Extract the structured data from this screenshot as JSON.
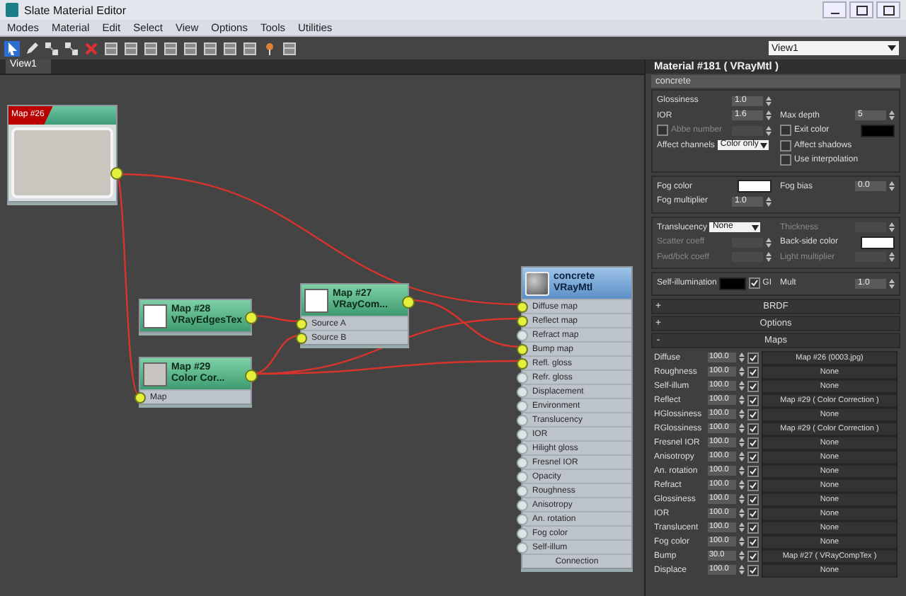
{
  "window": {
    "title": "Slate Material Editor"
  },
  "menu": [
    "Modes",
    "Material",
    "Edit",
    "Select",
    "View",
    "Options",
    "Tools",
    "Utilities"
  ],
  "toolbar": {
    "view_dropdown": "View1"
  },
  "view_tabs": [
    {
      "label": "View1",
      "selected": true
    }
  ],
  "nodes": [
    {
      "kind": "bitmap",
      "tag": "Map #26"
    },
    {
      "kind": "map",
      "title": "Map #28",
      "subtitle": "VRayEdgesTex",
      "color": "#ffffff"
    },
    {
      "kind": "map",
      "title": "Map #29",
      "subtitle": "Color Cor...",
      "color": "#c8c4c0",
      "slots": [
        {
          "label": "Map",
          "connected": true
        }
      ]
    },
    {
      "kind": "map",
      "title": "Map #27",
      "subtitle": "VRayCom...",
      "color": "#ffffff",
      "slots": [
        {
          "label": "Source A",
          "connected": true
        },
        {
          "label": "Source B",
          "connected": true
        }
      ]
    },
    {
      "kind": "material",
      "title": "concrete",
      "subtitle": "VRayMtl",
      "footer": "Connection",
      "slots": [
        {
          "label": "Diffuse map",
          "connected": true
        },
        {
          "label": "Reflect map",
          "connected": true
        },
        {
          "label": "Refract map",
          "connected": false
        },
        {
          "label": "Bump map",
          "connected": true
        },
        {
          "label": "Refl. gloss",
          "connected": true
        },
        {
          "label": "Refr. gloss",
          "connected": false
        },
        {
          "label": "Displacement",
          "connected": false
        },
        {
          "label": "Environment",
          "connected": false
        },
        {
          "label": "Translucency",
          "connected": false
        },
        {
          "label": "IOR",
          "connected": false
        },
        {
          "label": "Hilight gloss",
          "connected": false
        },
        {
          "label": "Fresnel IOR",
          "connected": false
        },
        {
          "label": "Opacity",
          "connected": false
        },
        {
          "label": "Roughness",
          "connected": false
        },
        {
          "label": "Anisotropy",
          "connected": false
        },
        {
          "label": "An. rotation",
          "connected": false
        },
        {
          "label": "Fog color",
          "connected": false
        },
        {
          "label": "Self-illum",
          "connected": false
        }
      ]
    }
  ],
  "panel": {
    "title": "Material #181 ( VRayMtl )",
    "name": "concrete",
    "groups": [
      {
        "rows": [
          {
            "left": {
              "kind": "spinner",
              "label": "Glossiness",
              "value": "1.0",
              "disabled": false
            }
          },
          {
            "left": {
              "kind": "spinner",
              "label": "IOR",
              "value": "1.6",
              "disabled": false
            },
            "right": {
              "kind": "spinner",
              "label": "Max depth",
              "value": "5",
              "disabled": false
            }
          },
          {
            "left": {
              "kind": "checkspinner",
              "label": "Abbe number",
              "checked": false,
              "disabled": true
            },
            "right": {
              "kind": "checkcolor",
              "label": "Exit color",
              "checked": false,
              "color": "#000000"
            }
          },
          {
            "left": {
              "kind": "dropdown",
              "label": "Affect channels",
              "value": "Color only"
            },
            "right": {
              "kind": "check",
              "label": "Affect shadows",
              "checked": false
            }
          },
          {
            "right": {
              "kind": "check",
              "label": "Use interpolation",
              "checked": false
            }
          }
        ]
      },
      {
        "rows": [
          {
            "left": {
              "kind": "color",
              "label": "Fog color",
              "color": "#ffffff"
            },
            "right": {
              "kind": "spinner",
              "label": "Fog bias",
              "value": "0.0",
              "disabled": false
            }
          },
          {
            "left": {
              "kind": "spinner",
              "label": "Fog multiplier",
              "value": "1.0",
              "disabled": false
            }
          }
        ]
      },
      {
        "rows": [
          {
            "left": {
              "kind": "dropdown",
              "label": "Translucency",
              "value": "None"
            },
            "right": {
              "kind": "spinner",
              "label": "Thickness",
              "disabled": true
            }
          },
          {
            "left": {
              "kind": "spinner",
              "label": "Scatter coeff",
              "disabled": true
            },
            "right": {
              "kind": "color",
              "label": "Back-side color",
              "color": "#ffffff"
            }
          },
          {
            "left": {
              "kind": "spinner",
              "label": "Fwd/bck coeff",
              "disabled": true
            },
            "right": {
              "kind": "spinner",
              "label": "Light multiplier",
              "disabled": true
            }
          }
        ]
      },
      {
        "rows": [
          {
            "left": {
              "kind": "colorcheck",
              "label": "Self-illumination",
              "color": "#000000",
              "check_label": "GI",
              "checked": true
            },
            "right": {
              "kind": "spinner",
              "label": "Mult",
              "value": "1.0",
              "disabled": false
            }
          }
        ]
      }
    ],
    "rollouts": [
      {
        "sign": "+",
        "label": "BRDF"
      },
      {
        "sign": "+",
        "label": "Options"
      },
      {
        "sign": "-",
        "label": "Maps"
      }
    ],
    "maps": [
      {
        "label": "Diffuse",
        "amount": "100.0",
        "enabled": true,
        "map": "Map #26 (0003.jpg)"
      },
      {
        "label": "Roughness",
        "amount": "100.0",
        "enabled": true,
        "map": "None"
      },
      {
        "label": "Self-illum",
        "amount": "100.0",
        "enabled": true,
        "map": "None"
      },
      {
        "label": "Reflect",
        "amount": "100.0",
        "enabled": true,
        "map": "Map #29 ( Color Correction )"
      },
      {
        "label": "HGlossiness",
        "amount": "100.0",
        "enabled": true,
        "map": "None"
      },
      {
        "label": "RGlossiness",
        "amount": "100.0",
        "enabled": true,
        "map": "Map #29 ( Color Correction )"
      },
      {
        "label": "Fresnel IOR",
        "amount": "100.0",
        "enabled": true,
        "map": "None"
      },
      {
        "label": "Anisotropy",
        "amount": "100.0",
        "enabled": true,
        "map": "None"
      },
      {
        "label": "An. rotation",
        "amount": "100.0",
        "enabled": true,
        "map": "None"
      },
      {
        "label": "Refract",
        "amount": "100.0",
        "enabled": true,
        "map": "None"
      },
      {
        "label": "Glossiness",
        "amount": "100.0",
        "enabled": true,
        "map": "None"
      },
      {
        "label": "IOR",
        "amount": "100.0",
        "enabled": true,
        "map": "None"
      },
      {
        "label": "Translucent",
        "amount": "100.0",
        "enabled": true,
        "map": "None"
      },
      {
        "label": "Fog color",
        "amount": "100.0",
        "enabled": true,
        "map": "None"
      },
      {
        "label": "Bump",
        "amount": "30.0",
        "enabled": true,
        "map": "Map #27 ( VRayCompTex )"
      },
      {
        "label": "Displace",
        "amount": "100.0",
        "enabled": true,
        "map": "None"
      }
    ]
  }
}
